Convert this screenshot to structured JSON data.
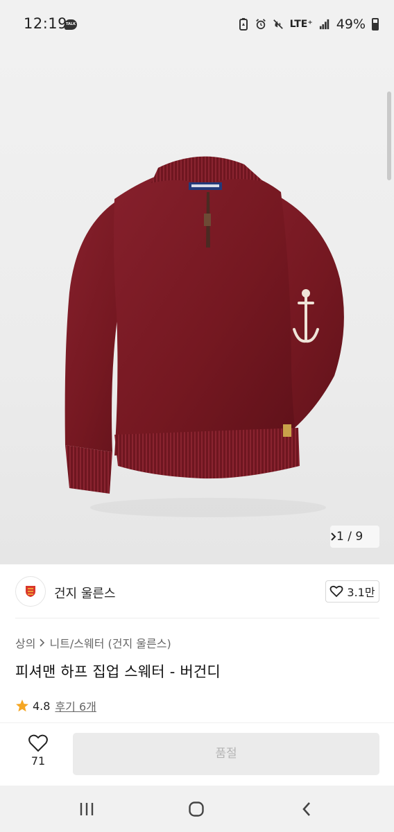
{
  "status_bar": {
    "time": "12:19",
    "talk_badge": "TALK",
    "network": "LTE⁺",
    "battery_percent": "49%"
  },
  "gallery": {
    "current": "1",
    "separator": "/",
    "total": "9",
    "pager_text": "1 / 9"
  },
  "brand": {
    "name": "건지 울른스",
    "likes": "3.1만"
  },
  "product": {
    "breadcrumb": [
      "상의",
      "니트/스웨터 (건지 울른스)"
    ],
    "title": "피셔맨 하프 집업 스웨터 - 버건디",
    "rating": "4.8",
    "reviews": "후기 6개"
  },
  "actions": {
    "wishlist_count": "71",
    "buy_label": "품절"
  },
  "colors": {
    "sweater": "#7a1a24",
    "star": "#f5a623",
    "button_disabled_bg": "#ebebeb",
    "button_disabled_text": "#b4b4b4"
  }
}
